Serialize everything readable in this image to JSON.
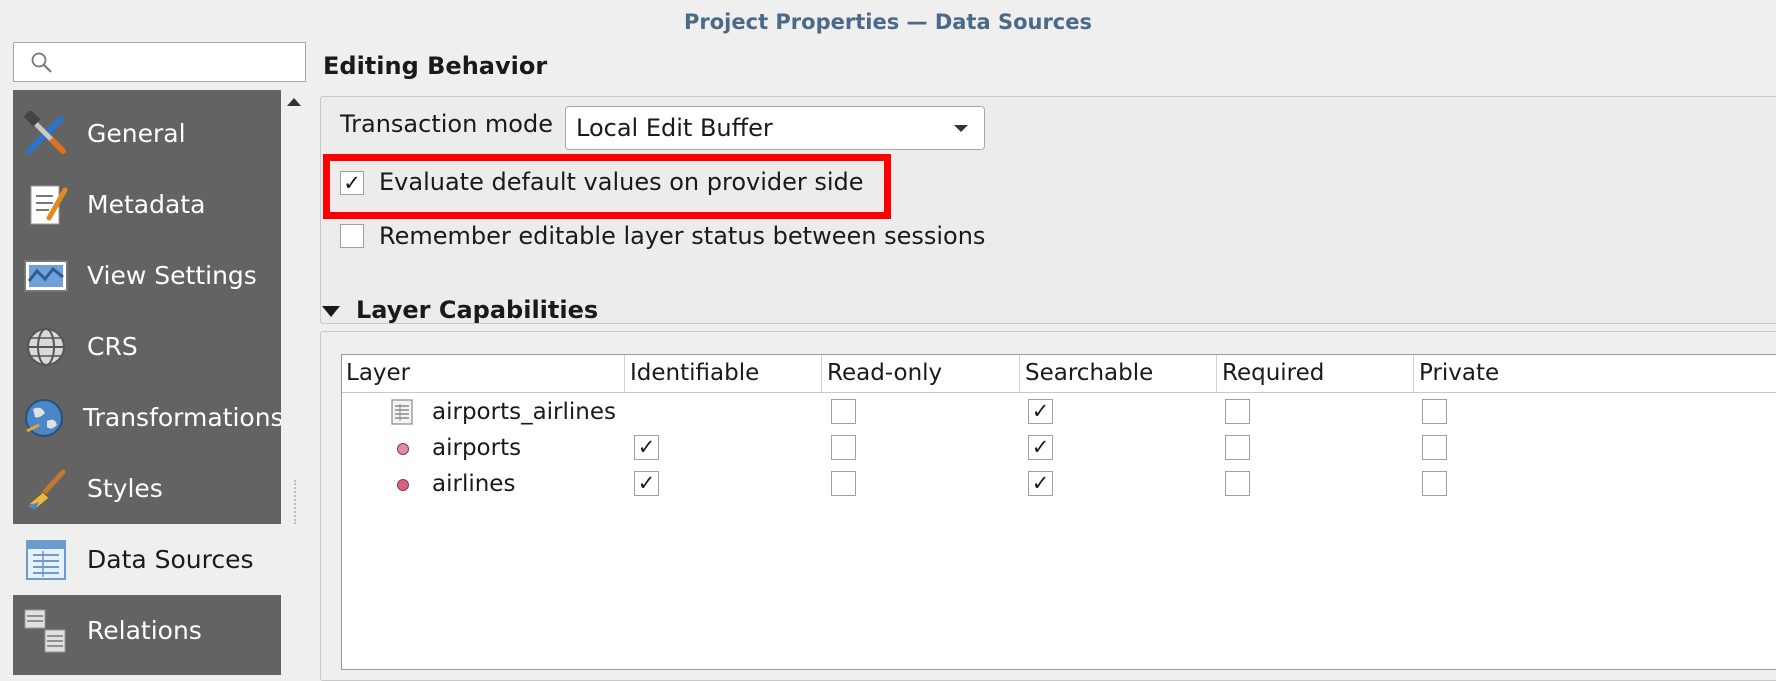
{
  "window": {
    "title": "Project Properties — Data Sources"
  },
  "search": {
    "placeholder": "",
    "icon": "search-icon"
  },
  "sidebar": {
    "items": [
      {
        "label": "General",
        "icon": "general-tools-icon",
        "active": false
      },
      {
        "label": "Metadata",
        "icon": "metadata-icon",
        "active": false
      },
      {
        "label": "View Settings",
        "icon": "view-settings-icon",
        "active": false
      },
      {
        "label": "CRS",
        "icon": "crs-globe-icon",
        "active": false
      },
      {
        "label": "Transformations",
        "icon": "transformations-globe-icon",
        "active": false
      },
      {
        "label": "Styles",
        "icon": "styles-brush-icon",
        "active": false
      },
      {
        "label": "Data Sources",
        "icon": "data-sources-table-icon",
        "active": true
      },
      {
        "label": "Relations",
        "icon": "relations-icon",
        "active": false
      }
    ]
  },
  "editing": {
    "heading": "Editing Behavior",
    "transaction_mode_label": "Transaction mode",
    "transaction_mode_value": "Local Edit Buffer",
    "evaluate_defaults_label": "Evaluate default values on provider side",
    "evaluate_defaults_checked": true,
    "remember_editable_label": "Remember editable layer status between sessions",
    "remember_editable_checked": false
  },
  "capabilities": {
    "heading": "Layer Capabilities",
    "columns": [
      "Layer",
      "Identifiable",
      "Read-only",
      "Searchable",
      "Required",
      "Private"
    ],
    "rows": [
      {
        "name": "airports_airlines",
        "icon": "table-layer-icon",
        "identifiable": null,
        "read_only": false,
        "searchable": true,
        "required": false,
        "private": false
      },
      {
        "name": "airports",
        "icon": "point-layer-icon",
        "identifiable": true,
        "read_only": false,
        "searchable": true,
        "required": false,
        "private": false
      },
      {
        "name": "airlines",
        "icon": "point-layer-icon",
        "identifiable": true,
        "read_only": false,
        "searchable": true,
        "required": false,
        "private": false
      }
    ]
  },
  "colors": {
    "sidebar_bg": "#636363",
    "title_text": "#4b6a88",
    "highlight_border": "#ff0000",
    "point_layer_fill": "#e38aa3"
  }
}
